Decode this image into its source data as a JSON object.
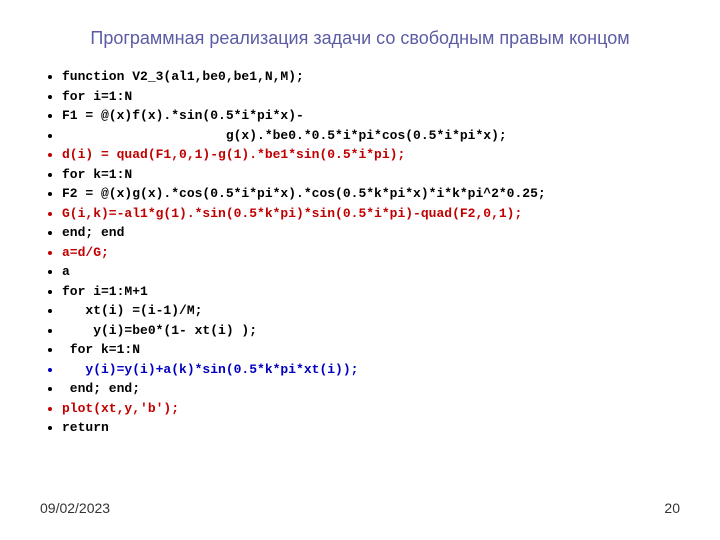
{
  "title": "Программная реализация задачи со свободным правым концом",
  "lines": [
    {
      "color": "black",
      "text": "function V2_3(al1,be0,be1,N,M);"
    },
    {
      "color": "black",
      "text": "for i=1:N"
    },
    {
      "color": "black",
      "text": "F1 = @(x)f(x).*sin(0.5*i*pi*x)-"
    },
    {
      "color": "black",
      "text": "                     g(x).*be0.*0.5*i*pi*cos(0.5*i*pi*x);"
    },
    {
      "color": "red",
      "text": "d(i) = quad(F1,0,1)-g(1).*be1*sin(0.5*i*pi);"
    },
    {
      "color": "black",
      "text": "for k=1:N"
    },
    {
      "color": "black",
      "text": "F2 = @(x)g(x).*cos(0.5*i*pi*x).*cos(0.5*k*pi*x)*i*k*pi^2*0.25;"
    },
    {
      "color": "red",
      "text": "G(i,k)=-al1*g(1).*sin(0.5*k*pi)*sin(0.5*i*pi)-quad(F2,0,1);"
    },
    {
      "color": "black",
      "text": "end; end"
    },
    {
      "color": "red",
      "text": "a=d/G;"
    },
    {
      "color": "black",
      "text": "a"
    },
    {
      "color": "black",
      "text": "for i=1:M+1"
    },
    {
      "color": "black",
      "text": "   xt(i) =(i-1)/M;"
    },
    {
      "color": "black",
      "text": "    y(i)=be0*(1- xt(i) );"
    },
    {
      "color": "black",
      "text": " for k=1:N"
    },
    {
      "color": "blue",
      "text": "   y(i)=y(i)+a(k)*sin(0.5*k*pi*xt(i));"
    },
    {
      "color": "black",
      "text": " end; end;"
    },
    {
      "color": "red",
      "text": "plot(xt,y,'b');"
    },
    {
      "color": "black",
      "text": "return"
    }
  ],
  "footer": {
    "date": "09/02/2023",
    "page": "20"
  }
}
